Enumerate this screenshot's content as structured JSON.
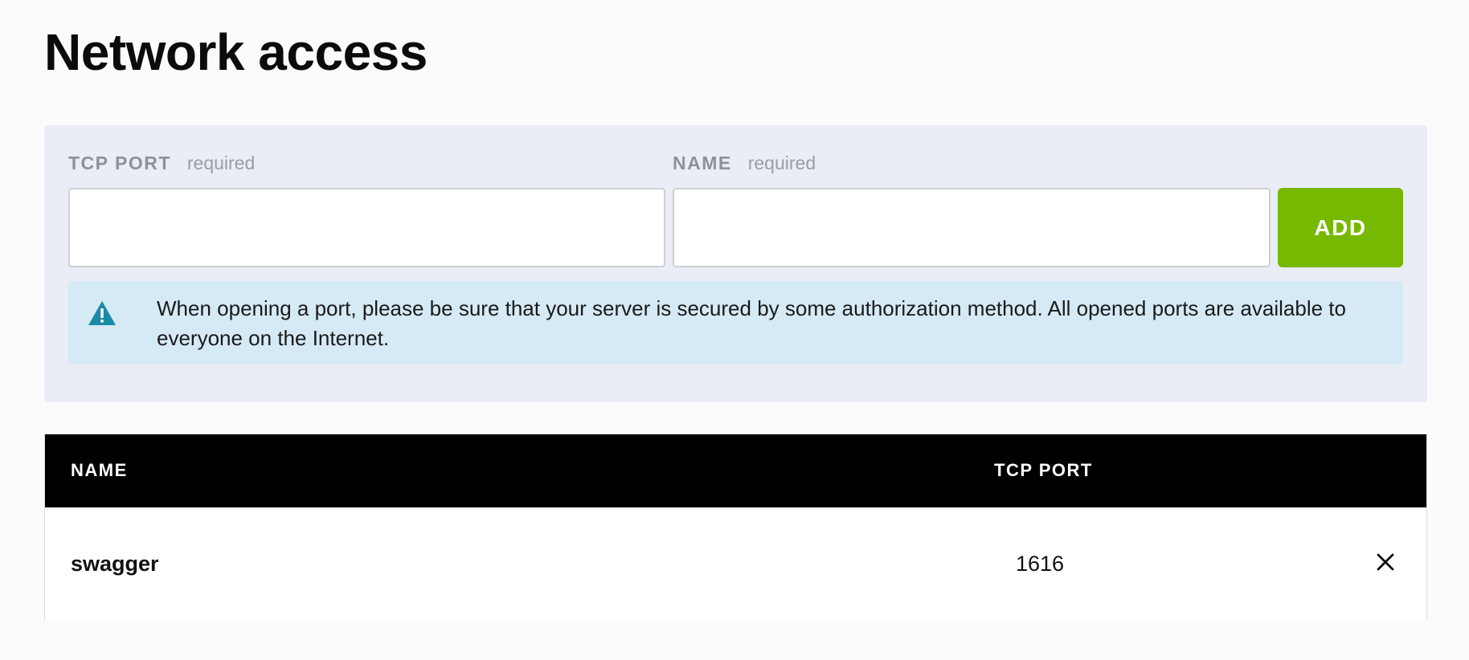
{
  "page": {
    "title": "Network access"
  },
  "form": {
    "port_label": "TCP PORT",
    "port_required": "required",
    "port_value": "",
    "name_label": "NAME",
    "name_required": "required",
    "name_value": "",
    "add_label": "ADD"
  },
  "alert": {
    "icon": "warning-triangle-icon",
    "text": "When opening a port, please be sure that your server is secured by some authorization method. All opened ports are available to everyone on the Internet."
  },
  "table": {
    "headers": {
      "name": "NAME",
      "port": "TCP PORT"
    },
    "rows": [
      {
        "name": "swagger",
        "port": "1616",
        "action_icon": "close-icon"
      }
    ]
  },
  "colors": {
    "accent": "#76b900",
    "panel_bg": "#eaedf6",
    "alert_bg": "#d6eaf5",
    "alert_icon": "#1b8aa6",
    "header_bg": "#000000"
  }
}
